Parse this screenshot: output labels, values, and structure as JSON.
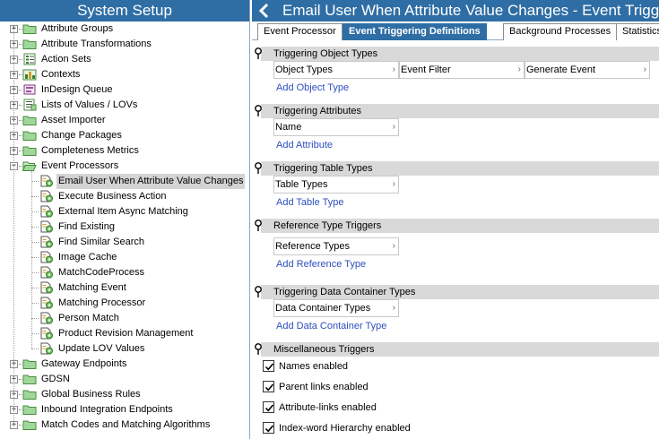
{
  "left_panel": {
    "header": "System Setup",
    "tree": [
      {
        "label": "Attribute Groups",
        "level": 0,
        "expander": "+",
        "icon": "folder-icon"
      },
      {
        "label": "Attribute Transformations",
        "level": 0,
        "expander": "+",
        "icon": "folder-icon"
      },
      {
        "label": "Action Sets",
        "level": 0,
        "expander": "+",
        "icon": "action-set-icon"
      },
      {
        "label": "Contexts",
        "level": 0,
        "expander": "+",
        "icon": "context-icon"
      },
      {
        "label": "InDesign Queue",
        "level": 0,
        "expander": "+",
        "icon": "indesign-queue-icon"
      },
      {
        "label": "Lists of Values / LOVs",
        "level": 0,
        "expander": "+",
        "icon": "lov-icon"
      },
      {
        "label": "Asset Importer",
        "level": 0,
        "expander": "+",
        "icon": "folder-icon"
      },
      {
        "label": "Change Packages",
        "level": 0,
        "expander": "+",
        "icon": "folder-icon"
      },
      {
        "label": "Completeness Metrics",
        "level": 0,
        "expander": "+",
        "icon": "folder-icon"
      },
      {
        "label": "Event Processors",
        "level": 0,
        "expander": "-",
        "icon": "folder-open-icon"
      },
      {
        "label": "Email User When Attribute Value Changes",
        "level": 1,
        "selected": true,
        "icon": "event-processor-icon"
      },
      {
        "label": "Execute Business Action",
        "level": 1,
        "icon": "event-processor-icon"
      },
      {
        "label": "External Item Async Matching",
        "level": 1,
        "icon": "event-processor-icon"
      },
      {
        "label": "Find Existing",
        "level": 1,
        "icon": "event-processor-icon"
      },
      {
        "label": "Find Similar Search",
        "level": 1,
        "icon": "event-processor-icon"
      },
      {
        "label": "Image Cache",
        "level": 1,
        "icon": "event-processor-icon"
      },
      {
        "label": "MatchCodeProcess",
        "level": 1,
        "icon": "event-processor-icon"
      },
      {
        "label": "Matching Event",
        "level": 1,
        "icon": "event-processor-icon"
      },
      {
        "label": "Matching Processor",
        "level": 1,
        "icon": "event-processor-icon"
      },
      {
        "label": "Person Match",
        "level": 1,
        "icon": "event-processor-icon"
      },
      {
        "label": "Product Revision Management",
        "level": 1,
        "icon": "event-processor-icon"
      },
      {
        "label": "Update LOV Values",
        "level": 1,
        "icon": "event-processor-icon"
      },
      {
        "label": "Gateway Endpoints",
        "level": 0,
        "expander": "+",
        "icon": "folder-icon"
      },
      {
        "label": "GDSN",
        "level": 0,
        "expander": "+",
        "icon": "folder-icon"
      },
      {
        "label": "Global Business Rules",
        "level": 0,
        "expander": "+",
        "icon": "folder-icon"
      },
      {
        "label": "Inbound Integration Endpoints",
        "level": 0,
        "expander": "+",
        "icon": "folder-icon"
      },
      {
        "label": "Match Codes and Matching Algorithms",
        "level": 0,
        "expander": "+",
        "icon": "folder-icon"
      }
    ]
  },
  "right_panel": {
    "title": "Email User When Attribute Value Changes - Event Trigg",
    "back_icon": "back-arrow-icon",
    "tabs": [
      {
        "label": "Event Processor",
        "active": false
      },
      {
        "label": "Event Triggering Definitions",
        "active": true
      },
      {
        "label": "Background Processes",
        "active": false
      },
      {
        "label": "Statistics",
        "active": false
      }
    ],
    "sections": {
      "object_types": {
        "title": "Triggering Object Types",
        "columns": [
          "Object Types",
          "Event Filter",
          "Generate Event"
        ],
        "add_link": "Add Object Type"
      },
      "attributes": {
        "title": "Triggering Attributes",
        "columns": [
          "Name"
        ],
        "add_link": "Add Attribute"
      },
      "table_types": {
        "title": "Triggering Table Types",
        "columns": [
          "Table Types"
        ],
        "add_link": "Add Table Type"
      },
      "reference_types": {
        "title": "Reference Type Triggers",
        "columns": [
          "Reference Types"
        ],
        "add_link": "Add Reference Type"
      },
      "data_container_types": {
        "title": "Triggering Data Container Types",
        "columns": [
          "Data Container Types"
        ],
        "add_link": "Add Data Container Type"
      },
      "misc": {
        "title": "Miscellaneous Triggers",
        "checkboxes": [
          {
            "label": "Names enabled",
            "checked": true
          },
          {
            "label": "Parent links enabled",
            "checked": true
          },
          {
            "label": "Attribute-links enabled",
            "checked": true
          },
          {
            "label": "Index-word Hierarchy enabled",
            "checked": true
          }
        ]
      }
    }
  },
  "colors": {
    "header_blue": "#2f6ea5",
    "section_gray": "#d9d9d9",
    "link_blue": "#2e4fc0",
    "selection_gray": "#d3d3d3"
  }
}
